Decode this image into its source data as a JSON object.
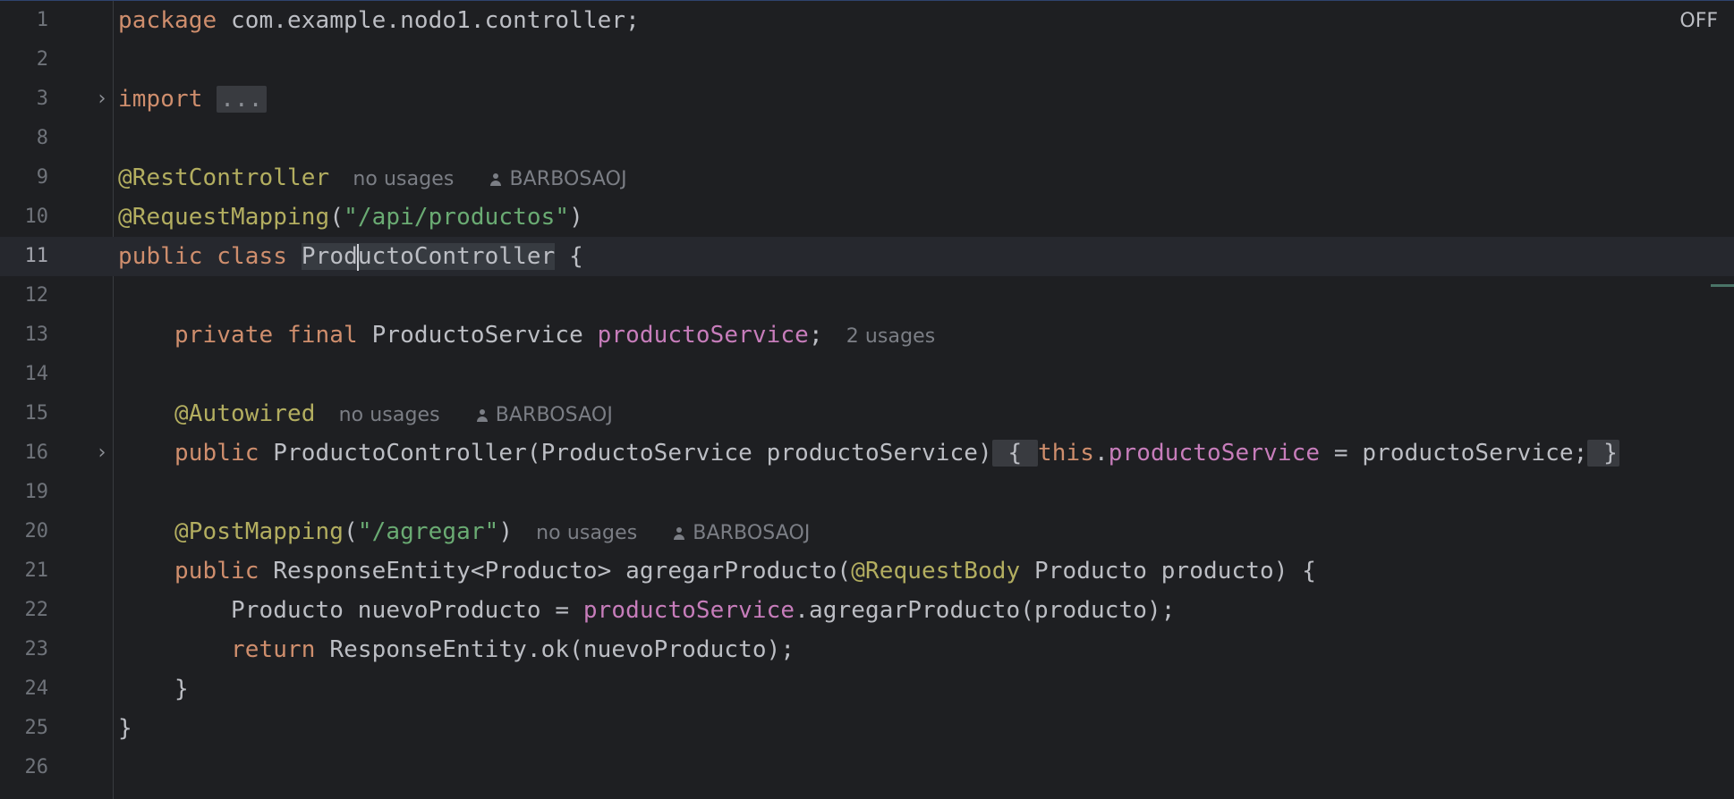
{
  "status": {
    "off_label": "OFF"
  },
  "lines": [
    {
      "num": "1"
    },
    {
      "num": "2"
    },
    {
      "num": "3"
    },
    {
      "num": "8"
    },
    {
      "num": "9"
    },
    {
      "num": "10"
    },
    {
      "num": "11"
    },
    {
      "num": "12"
    },
    {
      "num": "13"
    },
    {
      "num": "14"
    },
    {
      "num": "15"
    },
    {
      "num": "16"
    },
    {
      "num": "19"
    },
    {
      "num": "20"
    },
    {
      "num": "21"
    },
    {
      "num": "22"
    },
    {
      "num": "23"
    },
    {
      "num": "24"
    },
    {
      "num": "25"
    },
    {
      "num": "26"
    }
  ],
  "code": {
    "l1_kw": "package",
    "l1_rest": " com.example.nodo1.controller;",
    "l3_kw": "import",
    "l3_fold": "...",
    "l9_ann": "@RestController",
    "l9_hint": "no usages",
    "l9_author": "BARBOSAOJ",
    "l10_ann": "@RequestMapping",
    "l10_open": "(",
    "l10_str": "\"/api/productos\"",
    "l10_close": ")",
    "l11_kw": "public class",
    "l11_space": " ",
    "l11_name_a": "Prod",
    "l11_name_b": "uctoController",
    "l11_rest": " {",
    "l13_indent": "    ",
    "l13_kw": "private final",
    "l13_type": " ProductoService ",
    "l13_field": "productoService",
    "l13_end": ";",
    "l13_hint": "2 usages",
    "l15_indent": "    ",
    "l15_ann": "@Autowired",
    "l15_hint": "no usages",
    "l15_author": "BARBOSAOJ",
    "l16_indent": "    ",
    "l16_kw": "public",
    "l16_sig": " ProductoController(ProductoService productoService)",
    "l16_obrace": " { ",
    "l16_this": "this",
    "l16_dot": ".",
    "l16_field": "productoService",
    "l16_assign": " = productoService;",
    "l16_cbrace": " }",
    "l20_indent": "    ",
    "l20_ann": "@PostMapping",
    "l20_open": "(",
    "l20_str": "\"/agregar\"",
    "l20_close": ")",
    "l20_hint": "no usages",
    "l20_author": "BARBOSAOJ",
    "l21_indent": "    ",
    "l21_kw": "public",
    "l21_rest": " ResponseEntity<Producto> agregarProducto(",
    "l21_ann": "@RequestBody",
    "l21_rest2": " Producto producto) {",
    "l22_indent": "        ",
    "l22_rest": "Producto nuevoProducto = ",
    "l22_field": "productoService",
    "l22_rest2": ".agregarProducto(producto);",
    "l23_indent": "        ",
    "l23_kw": "return",
    "l23_rest": " ResponseEntity.ok(nuevoProducto);",
    "l24_indent": "    ",
    "l24_rest": "}",
    "l25_rest": "}"
  }
}
